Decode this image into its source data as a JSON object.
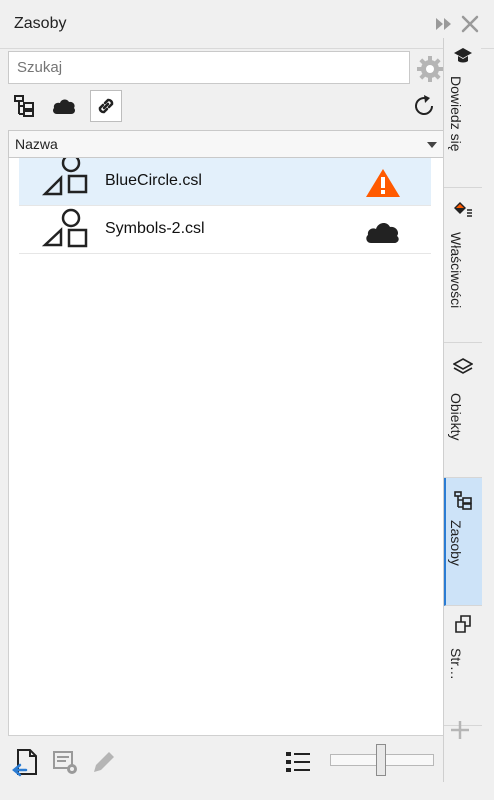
{
  "window": {
    "title": "Zasoby"
  },
  "search": {
    "placeholder": "Szukaj"
  },
  "sort": {
    "label": "Nazwa"
  },
  "list": {
    "items": [
      {
        "name": "BlueCircle.csl",
        "status": "warning"
      },
      {
        "name": "Symbols-2.csl",
        "status": "cloud"
      }
    ]
  },
  "sidebar": {
    "tabs": [
      {
        "label": "Dowiedz się",
        "icon": "learn-icon"
      },
      {
        "label": "Właściwości",
        "icon": "properties-icon"
      },
      {
        "label": "Obiekty",
        "icon": "objects-icon"
      },
      {
        "label": "Zasoby",
        "icon": "assets-icon",
        "active": true
      },
      {
        "label": "Str…",
        "icon": "pages-icon"
      }
    ]
  },
  "colors": {
    "accent": "#2b7cd3",
    "warning": "#ff5a00",
    "selected_row": "#e3f0fb"
  }
}
